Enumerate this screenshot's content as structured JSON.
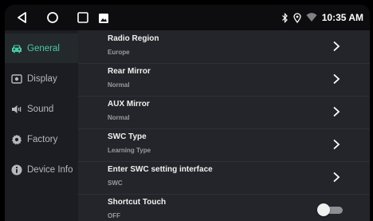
{
  "status_bar": {
    "nav_icons": [
      "back-icon",
      "home-icon",
      "recent-apps-icon",
      "image-icon"
    ],
    "status_icons": [
      "bluetooth-icon",
      "location-icon",
      "wifi-icon"
    ],
    "time": "10:35 AM"
  },
  "sidebar": {
    "accent_color": "#49c8a8",
    "items": [
      {
        "label": "General",
        "icon": "car-icon",
        "active": true
      },
      {
        "label": "Display",
        "icon": "display-icon",
        "active": false
      },
      {
        "label": "Sound",
        "icon": "speaker-icon",
        "active": false
      },
      {
        "label": "Factory",
        "icon": "gear-icon",
        "active": false
      },
      {
        "label": "Device Info",
        "icon": "info-icon",
        "active": false
      }
    ]
  },
  "settings": [
    {
      "title": "Radio Region",
      "value": "Europe",
      "control": "chevron"
    },
    {
      "title": "Rear Mirror",
      "value": "Normal",
      "control": "chevron"
    },
    {
      "title": "AUX Mirror",
      "value": "Normal",
      "control": "chevron"
    },
    {
      "title": "SWC Type",
      "value": "Learning Type",
      "control": "chevron"
    },
    {
      "title": "Enter SWC setting interface",
      "value": "SWC",
      "control": "chevron"
    },
    {
      "title": "Shortcut Touch",
      "value": "OFF",
      "control": "toggle",
      "toggle_on": false
    }
  ]
}
